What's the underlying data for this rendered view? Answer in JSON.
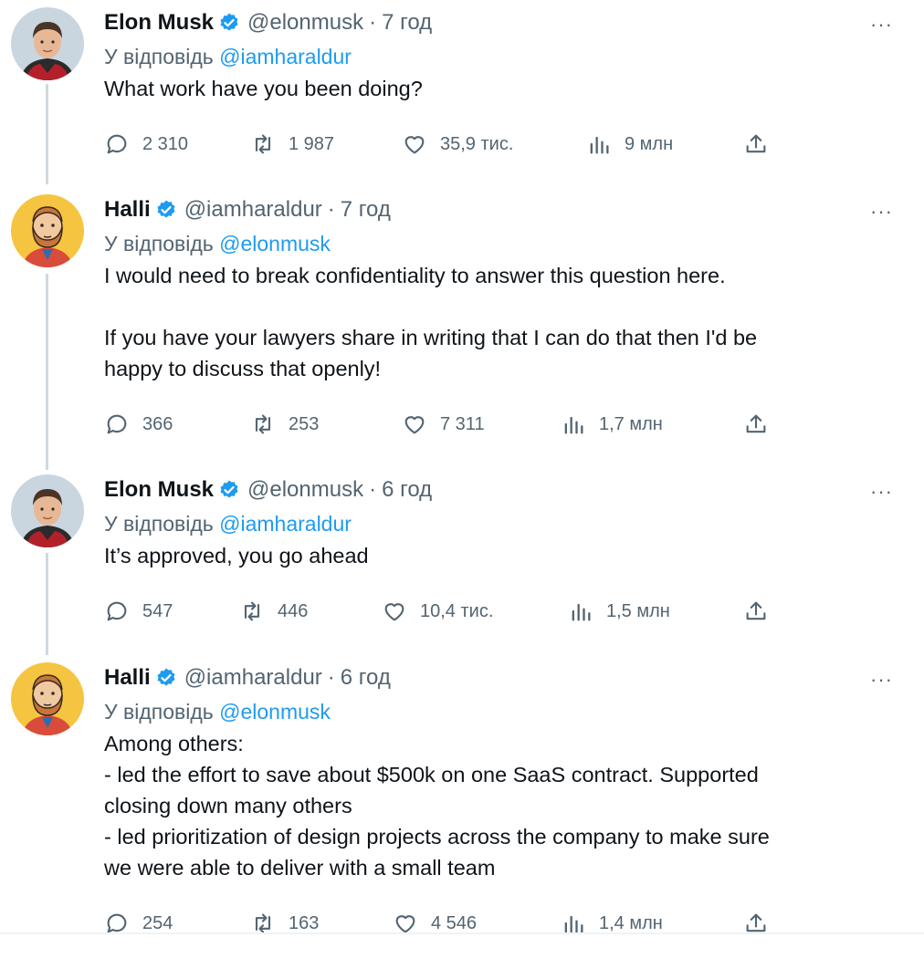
{
  "tweets": [
    {
      "author": "Elon Musk",
      "handle": "@elonmusk",
      "time": "7 год",
      "reply_prefix": "У відповідь",
      "reply_to": "@iamharaldur",
      "text": [
        "What work have you been doing?"
      ],
      "replies": "2 310",
      "retweets": "1 987",
      "likes": "35,9 тис.",
      "views": "9 млн"
    },
    {
      "author": "Halli",
      "handle": "@iamharaldur",
      "time": "7 год",
      "reply_prefix": "У відповідь",
      "reply_to": "@elonmusk",
      "text": [
        "I would need to break confidentiality to answer this question here.",
        "",
        "If you have your lawyers share in writing that I can do that then I'd be",
        "happy to discuss that openly!"
      ],
      "replies": "366",
      "retweets": "253",
      "likes": "7 311",
      "views": "1,7 млн"
    },
    {
      "author": "Elon Musk",
      "handle": "@elonmusk",
      "time": "6 год",
      "reply_prefix": "У відповідь",
      "reply_to": "@iamharaldur",
      "text": [
        "It’s approved, you go ahead"
      ],
      "replies": "547",
      "retweets": "446",
      "likes": "10,4 тис.",
      "views": "1,5 млн"
    },
    {
      "author": "Halli",
      "handle": "@iamharaldur",
      "time": "6 год",
      "reply_prefix": "У відповідь",
      "reply_to": "@elonmusk",
      "text": [
        "Among others:",
        "- led the effort to save about $500k on one SaaS contract. Supported",
        "closing down many others",
        "- led prioritization of design projects across the company to make sure",
        "we were able to deliver with a small team"
      ],
      "replies": "254",
      "retweets": "163",
      "likes": "4 546",
      "views": "1,4 млн"
    }
  ],
  "icons": {
    "reply": "reply-icon",
    "retweet": "retweet-icon",
    "like": "heart-icon",
    "views": "views-icon",
    "share": "share-icon",
    "more": "more-icon",
    "verified": "verified-badge-icon"
  },
  "colors": {
    "link": "#1d9bf0",
    "verified": "#1d9bf0",
    "muted": "#536471",
    "text": "#0f1419",
    "thread_line": "#cfd9de"
  },
  "more_symbol": "···"
}
